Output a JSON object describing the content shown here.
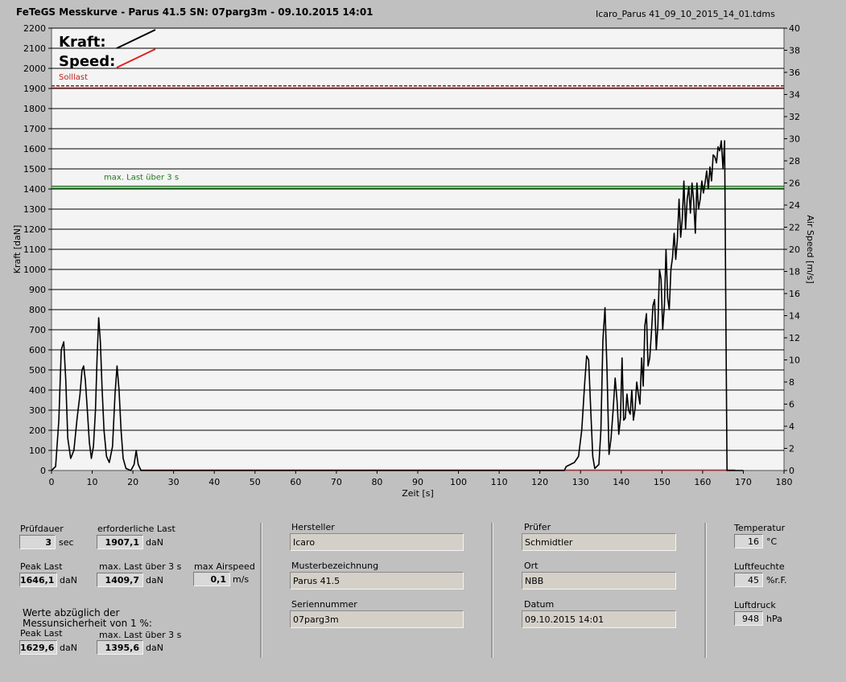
{
  "header": {
    "title": "FeTeGS Messkurve - Parus 41.5  SN: 07parg3m - 09.10.2015 14:01",
    "file": "Icaro_Parus 41_09_10_2015_14_01.tdms"
  },
  "chart_data": {
    "type": "line",
    "xlabel": "Zeit [s]",
    "ylabel": "Kraft [daN]",
    "y2label": "Air Speed [m/s]",
    "xlim": [
      0,
      180
    ],
    "ylim": [
      0,
      2200
    ],
    "y2lim": [
      0,
      40
    ],
    "xticks": [
      0,
      10,
      20,
      30,
      40,
      50,
      60,
      70,
      80,
      90,
      100,
      110,
      120,
      130,
      140,
      150,
      160,
      170,
      180
    ],
    "yticks": [
      0,
      100,
      200,
      300,
      400,
      500,
      600,
      700,
      800,
      900,
      1000,
      1100,
      1200,
      1300,
      1400,
      1500,
      1600,
      1700,
      1800,
      1900,
      2000,
      2100,
      2200
    ],
    "y2ticks": [
      0,
      2,
      4,
      6,
      8,
      10,
      12,
      14,
      16,
      18,
      20,
      22,
      24,
      26,
      28,
      30,
      32,
      34,
      36,
      38,
      40
    ],
    "legend": [
      {
        "name": "Kraft:",
        "color": "#000000"
      },
      {
        "name": "Speed:",
        "color": "#e02020"
      }
    ],
    "legend_position": "top-left",
    "grid": "horizontal",
    "reference_lines": [
      {
        "label": "Solllast",
        "value": 1907.1,
        "color": "#8b1a1a",
        "style": "dashed"
      },
      {
        "label": "max. Last über  3 s",
        "value": 1409.7,
        "color": "#1e7a1e",
        "style": "solid"
      }
    ],
    "series": [
      {
        "name": "Kraft:",
        "color": "#000000",
        "points": [
          [
            0,
            0
          ],
          [
            1,
            20
          ],
          [
            1.8,
            250
          ],
          [
            2.4,
            600
          ],
          [
            3,
            640
          ],
          [
            3.5,
            450
          ],
          [
            4,
            160
          ],
          [
            4.7,
            60
          ],
          [
            5.5,
            100
          ],
          [
            6.3,
            260
          ],
          [
            7,
            380
          ],
          [
            7.5,
            500
          ],
          [
            7.9,
            520
          ],
          [
            8.3,
            450
          ],
          [
            8.8,
            300
          ],
          [
            9.3,
            140
          ],
          [
            9.8,
            60
          ],
          [
            10.3,
            120
          ],
          [
            10.8,
            300
          ],
          [
            11.2,
            560
          ],
          [
            11.6,
            760
          ],
          [
            12,
            640
          ],
          [
            12.4,
            420
          ],
          [
            12.9,
            200
          ],
          [
            13.5,
            70
          ],
          [
            14.2,
            40
          ],
          [
            15,
            120
          ],
          [
            15.6,
            380
          ],
          [
            16.1,
            520
          ],
          [
            16.6,
            400
          ],
          [
            17.1,
            200
          ],
          [
            17.6,
            60
          ],
          [
            18.3,
            10
          ],
          [
            19.5,
            0
          ],
          [
            20.3,
            30
          ],
          [
            20.8,
            100
          ],
          [
            21.3,
            30
          ],
          [
            22,
            0
          ],
          [
            126,
            0
          ],
          [
            126.5,
            20
          ],
          [
            127.5,
            30
          ],
          [
            128.5,
            40
          ],
          [
            129.5,
            70
          ],
          [
            130.3,
            200
          ],
          [
            131,
            430
          ],
          [
            131.5,
            570
          ],
          [
            132,
            550
          ],
          [
            132.5,
            300
          ],
          [
            133,
            70
          ],
          [
            133.5,
            10
          ],
          [
            134.5,
            30
          ],
          [
            135,
            200
          ],
          [
            135.5,
            650
          ],
          [
            136,
            810
          ],
          [
            136.5,
            500
          ],
          [
            137,
            80
          ],
          [
            137.5,
            160
          ],
          [
            138,
            300
          ],
          [
            138.5,
            460
          ],
          [
            139,
            340
          ],
          [
            139.4,
            180
          ],
          [
            139.8,
            260
          ],
          [
            140.2,
            560
          ],
          [
            140.6,
            250
          ],
          [
            141,
            260
          ],
          [
            141.4,
            380
          ],
          [
            141.8,
            300
          ],
          [
            142.2,
            280
          ],
          [
            142.6,
            400
          ],
          [
            143,
            250
          ],
          [
            143.4,
            310
          ],
          [
            143.8,
            440
          ],
          [
            144.2,
            380
          ],
          [
            144.6,
            330
          ],
          [
            145,
            560
          ],
          [
            145.4,
            420
          ],
          [
            145.8,
            720
          ],
          [
            146.2,
            780
          ],
          [
            146.6,
            520
          ],
          [
            147,
            560
          ],
          [
            147.4,
            680
          ],
          [
            147.8,
            820
          ],
          [
            148.2,
            850
          ],
          [
            148.6,
            600
          ],
          [
            149,
            720
          ],
          [
            149.4,
            1000
          ],
          [
            149.8,
            950
          ],
          [
            150.2,
            700
          ],
          [
            150.6,
            820
          ],
          [
            151,
            1100
          ],
          [
            151.4,
            860
          ],
          [
            151.8,
            800
          ],
          [
            152.2,
            1000
          ],
          [
            152.6,
            1060
          ],
          [
            153,
            1180
          ],
          [
            153.4,
            1050
          ],
          [
            153.8,
            1150
          ],
          [
            154.2,
            1350
          ],
          [
            154.6,
            1160
          ],
          [
            155,
            1250
          ],
          [
            155.4,
            1440
          ],
          [
            155.8,
            1200
          ],
          [
            156.2,
            1350
          ],
          [
            156.6,
            1410
          ],
          [
            157,
            1280
          ],
          [
            157.4,
            1430
          ],
          [
            157.8,
            1340
          ],
          [
            158.2,
            1180
          ],
          [
            158.6,
            1430
          ],
          [
            159,
            1300
          ],
          [
            159.4,
            1350
          ],
          [
            159.8,
            1440
          ],
          [
            160.2,
            1380
          ],
          [
            160.6,
            1430
          ],
          [
            161,
            1490
          ],
          [
            161.4,
            1400
          ],
          [
            161.8,
            1510
          ],
          [
            162.2,
            1440
          ],
          [
            162.6,
            1570
          ],
          [
            163,
            1560
          ],
          [
            163.4,
            1530
          ],
          [
            163.8,
            1610
          ],
          [
            164.2,
            1590
          ],
          [
            164.6,
            1640
          ],
          [
            165,
            1500
          ],
          [
            165.4,
            1640
          ],
          [
            165.7,
            800
          ],
          [
            166,
            0
          ],
          [
            168,
            0
          ],
          [
            170,
            0
          ]
        ]
      }
    ]
  },
  "panel": {
    "pruefdauer": {
      "label": "Prüfdauer",
      "value": "3",
      "unit": "sec"
    },
    "erf_last": {
      "label": "erforderliche Last",
      "value": "1907,1",
      "unit": "daN"
    },
    "peak_last": {
      "label": "Peak Last",
      "value": "1646,1",
      "unit": "daN"
    },
    "max_last": {
      "label": "max. Last über  3 s",
      "value": "1409,7",
      "unit": "daN"
    },
    "max_airspeed": {
      "label": "max Airspeed",
      "value": "0,1",
      "unit": "m/s"
    },
    "werte_note": "Werte abzüglich der",
    "werte_note2": "Messunsicherheit von 1  %:",
    "peak_last_corr": {
      "label": "Peak Last",
      "value": "1629,6",
      "unit": "daN"
    },
    "max_last_corr": {
      "label": "max. Last über  3 s",
      "value": "1395,6",
      "unit": "daN"
    },
    "hersteller": {
      "label": "Hersteller",
      "value": "Icaro"
    },
    "muster": {
      "label": "Musterbezeichnung",
      "value": "Parus 41.5"
    },
    "serien": {
      "label": "Seriennummer",
      "value": "07parg3m"
    },
    "pruefer": {
      "label": "Prüfer",
      "value": "Schmidtler"
    },
    "ort": {
      "label": "Ort",
      "value": "NBB"
    },
    "datum": {
      "label": "Datum",
      "value": "09.10.2015 14:01"
    },
    "temperatur": {
      "label": "Temperatur",
      "value": "16",
      "unit": "°C"
    },
    "luftfeuchte": {
      "label": "Luftfeuchte",
      "value": "45",
      "unit": "%r.F."
    },
    "luftdruck": {
      "label": "Luftdruck",
      "value": "948",
      "unit": "hPa"
    }
  }
}
